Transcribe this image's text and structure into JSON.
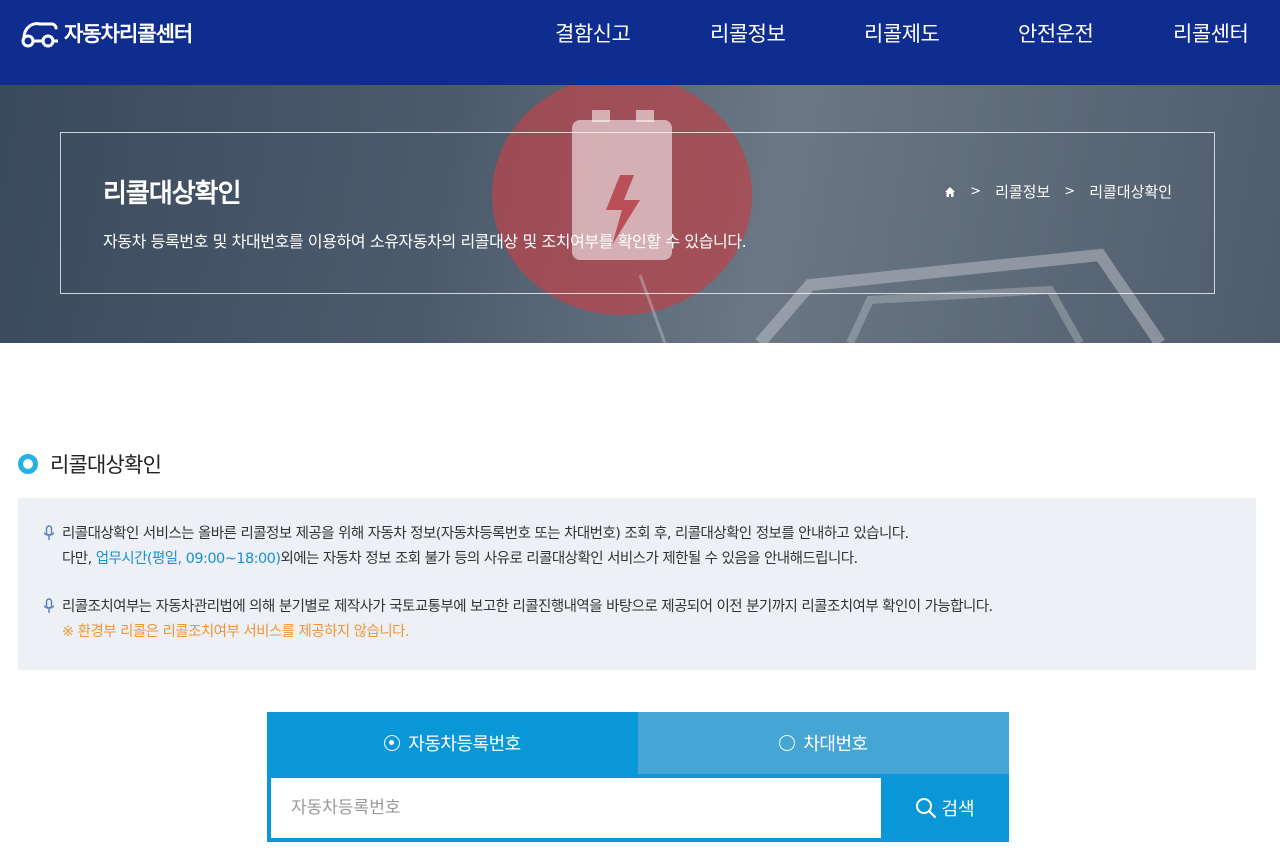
{
  "header": {
    "logo_text": "자동차리콜센터",
    "nav": [
      "결함신고",
      "리콜정보",
      "리콜제도",
      "안전운전",
      "리콜센터"
    ]
  },
  "hero": {
    "title": "리콜대상확인",
    "description": "자동차 등록번호 및 차대번호를 이용하여 소유자동차의 리콜대상 및 조치여부를 확인할 수 있습니다.",
    "breadcrumb": [
      "리콜정보",
      "리콜대상확인"
    ]
  },
  "section": {
    "title": "리콜대상확인"
  },
  "info": {
    "block1_line1": "리콜대상확인 서비스는 올바른 리콜정보 제공을 위해 자동차 정보(자동차등록번호 또는 차대번호) 조회 후, 리콜대상확인 정보를 안내하고 있습니다.",
    "block1_line2_pre": "다만, ",
    "block1_line2_hl": "업무시간(평일, 09:00~18:00)",
    "block1_line2_post": "외에는 자동차 정보 조회 불가 등의 사유로 리콜대상확인 서비스가 제한될 수 있음을 안내해드립니다.",
    "block2_line1": "리콜조치여부는 자동차관리법에 의해 분기별로 제작사가 국토교통부에 보고한 리콜진행내역을 바탕으로 제공되어 이전 분기까지 리콜조치여부 확인이 가능합니다.",
    "block2_line2": "※ 환경부 리콜은 리콜조치여부 서비스를 제공하지 않습니다."
  },
  "search": {
    "tabs": [
      {
        "label": "자동차등록번호",
        "selected": true
      },
      {
        "label": "차대번호",
        "selected": false
      }
    ],
    "placeholder": "자동차등록번호",
    "value": "",
    "button_label": "검색"
  },
  "colors": {
    "header_bg": "#0e2d8e",
    "tab_active": "#0a97d8",
    "tab_inactive": "#45a5d4",
    "accent_cyan": "#23b1e8",
    "highlight_blue": "#1a8fd0",
    "highlight_orange": "#f39436",
    "info_bg": "#edf1f5"
  },
  "icons": [
    "car-link-logo-icon",
    "home-icon",
    "chevron-right-icon",
    "microphone-icon",
    "radio-icon",
    "search-icon"
  ]
}
